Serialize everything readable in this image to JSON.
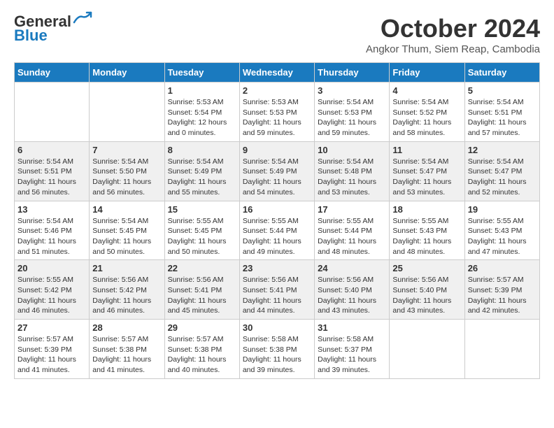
{
  "header": {
    "logo_line1": "General",
    "logo_line2": "Blue",
    "month": "October 2024",
    "location": "Angkor Thum, Siem Reap, Cambodia"
  },
  "weekdays": [
    "Sunday",
    "Monday",
    "Tuesday",
    "Wednesday",
    "Thursday",
    "Friday",
    "Saturday"
  ],
  "weeks": [
    [
      {
        "day": "",
        "info": ""
      },
      {
        "day": "",
        "info": ""
      },
      {
        "day": "1",
        "info": "Sunrise: 5:53 AM\nSunset: 5:54 PM\nDaylight: 12 hours\nand 0 minutes."
      },
      {
        "day": "2",
        "info": "Sunrise: 5:53 AM\nSunset: 5:53 PM\nDaylight: 11 hours\nand 59 minutes."
      },
      {
        "day": "3",
        "info": "Sunrise: 5:54 AM\nSunset: 5:53 PM\nDaylight: 11 hours\nand 59 minutes."
      },
      {
        "day": "4",
        "info": "Sunrise: 5:54 AM\nSunset: 5:52 PM\nDaylight: 11 hours\nand 58 minutes."
      },
      {
        "day": "5",
        "info": "Sunrise: 5:54 AM\nSunset: 5:51 PM\nDaylight: 11 hours\nand 57 minutes."
      }
    ],
    [
      {
        "day": "6",
        "info": "Sunrise: 5:54 AM\nSunset: 5:51 PM\nDaylight: 11 hours\nand 56 minutes."
      },
      {
        "day": "7",
        "info": "Sunrise: 5:54 AM\nSunset: 5:50 PM\nDaylight: 11 hours\nand 56 minutes."
      },
      {
        "day": "8",
        "info": "Sunrise: 5:54 AM\nSunset: 5:49 PM\nDaylight: 11 hours\nand 55 minutes."
      },
      {
        "day": "9",
        "info": "Sunrise: 5:54 AM\nSunset: 5:49 PM\nDaylight: 11 hours\nand 54 minutes."
      },
      {
        "day": "10",
        "info": "Sunrise: 5:54 AM\nSunset: 5:48 PM\nDaylight: 11 hours\nand 53 minutes."
      },
      {
        "day": "11",
        "info": "Sunrise: 5:54 AM\nSunset: 5:47 PM\nDaylight: 11 hours\nand 53 minutes."
      },
      {
        "day": "12",
        "info": "Sunrise: 5:54 AM\nSunset: 5:47 PM\nDaylight: 11 hours\nand 52 minutes."
      }
    ],
    [
      {
        "day": "13",
        "info": "Sunrise: 5:54 AM\nSunset: 5:46 PM\nDaylight: 11 hours\nand 51 minutes."
      },
      {
        "day": "14",
        "info": "Sunrise: 5:54 AM\nSunset: 5:45 PM\nDaylight: 11 hours\nand 50 minutes."
      },
      {
        "day": "15",
        "info": "Sunrise: 5:55 AM\nSunset: 5:45 PM\nDaylight: 11 hours\nand 50 minutes."
      },
      {
        "day": "16",
        "info": "Sunrise: 5:55 AM\nSunset: 5:44 PM\nDaylight: 11 hours\nand 49 minutes."
      },
      {
        "day": "17",
        "info": "Sunrise: 5:55 AM\nSunset: 5:44 PM\nDaylight: 11 hours\nand 48 minutes."
      },
      {
        "day": "18",
        "info": "Sunrise: 5:55 AM\nSunset: 5:43 PM\nDaylight: 11 hours\nand 48 minutes."
      },
      {
        "day": "19",
        "info": "Sunrise: 5:55 AM\nSunset: 5:43 PM\nDaylight: 11 hours\nand 47 minutes."
      }
    ],
    [
      {
        "day": "20",
        "info": "Sunrise: 5:55 AM\nSunset: 5:42 PM\nDaylight: 11 hours\nand 46 minutes."
      },
      {
        "day": "21",
        "info": "Sunrise: 5:56 AM\nSunset: 5:42 PM\nDaylight: 11 hours\nand 46 minutes."
      },
      {
        "day": "22",
        "info": "Sunrise: 5:56 AM\nSunset: 5:41 PM\nDaylight: 11 hours\nand 45 minutes."
      },
      {
        "day": "23",
        "info": "Sunrise: 5:56 AM\nSunset: 5:41 PM\nDaylight: 11 hours\nand 44 minutes."
      },
      {
        "day": "24",
        "info": "Sunrise: 5:56 AM\nSunset: 5:40 PM\nDaylight: 11 hours\nand 43 minutes."
      },
      {
        "day": "25",
        "info": "Sunrise: 5:56 AM\nSunset: 5:40 PM\nDaylight: 11 hours\nand 43 minutes."
      },
      {
        "day": "26",
        "info": "Sunrise: 5:57 AM\nSunset: 5:39 PM\nDaylight: 11 hours\nand 42 minutes."
      }
    ],
    [
      {
        "day": "27",
        "info": "Sunrise: 5:57 AM\nSunset: 5:39 PM\nDaylight: 11 hours\nand 41 minutes."
      },
      {
        "day": "28",
        "info": "Sunrise: 5:57 AM\nSunset: 5:38 PM\nDaylight: 11 hours\nand 41 minutes."
      },
      {
        "day": "29",
        "info": "Sunrise: 5:57 AM\nSunset: 5:38 PM\nDaylight: 11 hours\nand 40 minutes."
      },
      {
        "day": "30",
        "info": "Sunrise: 5:58 AM\nSunset: 5:38 PM\nDaylight: 11 hours\nand 39 minutes."
      },
      {
        "day": "31",
        "info": "Sunrise: 5:58 AM\nSunset: 5:37 PM\nDaylight: 11 hours\nand 39 minutes."
      },
      {
        "day": "",
        "info": ""
      },
      {
        "day": "",
        "info": ""
      }
    ]
  ]
}
